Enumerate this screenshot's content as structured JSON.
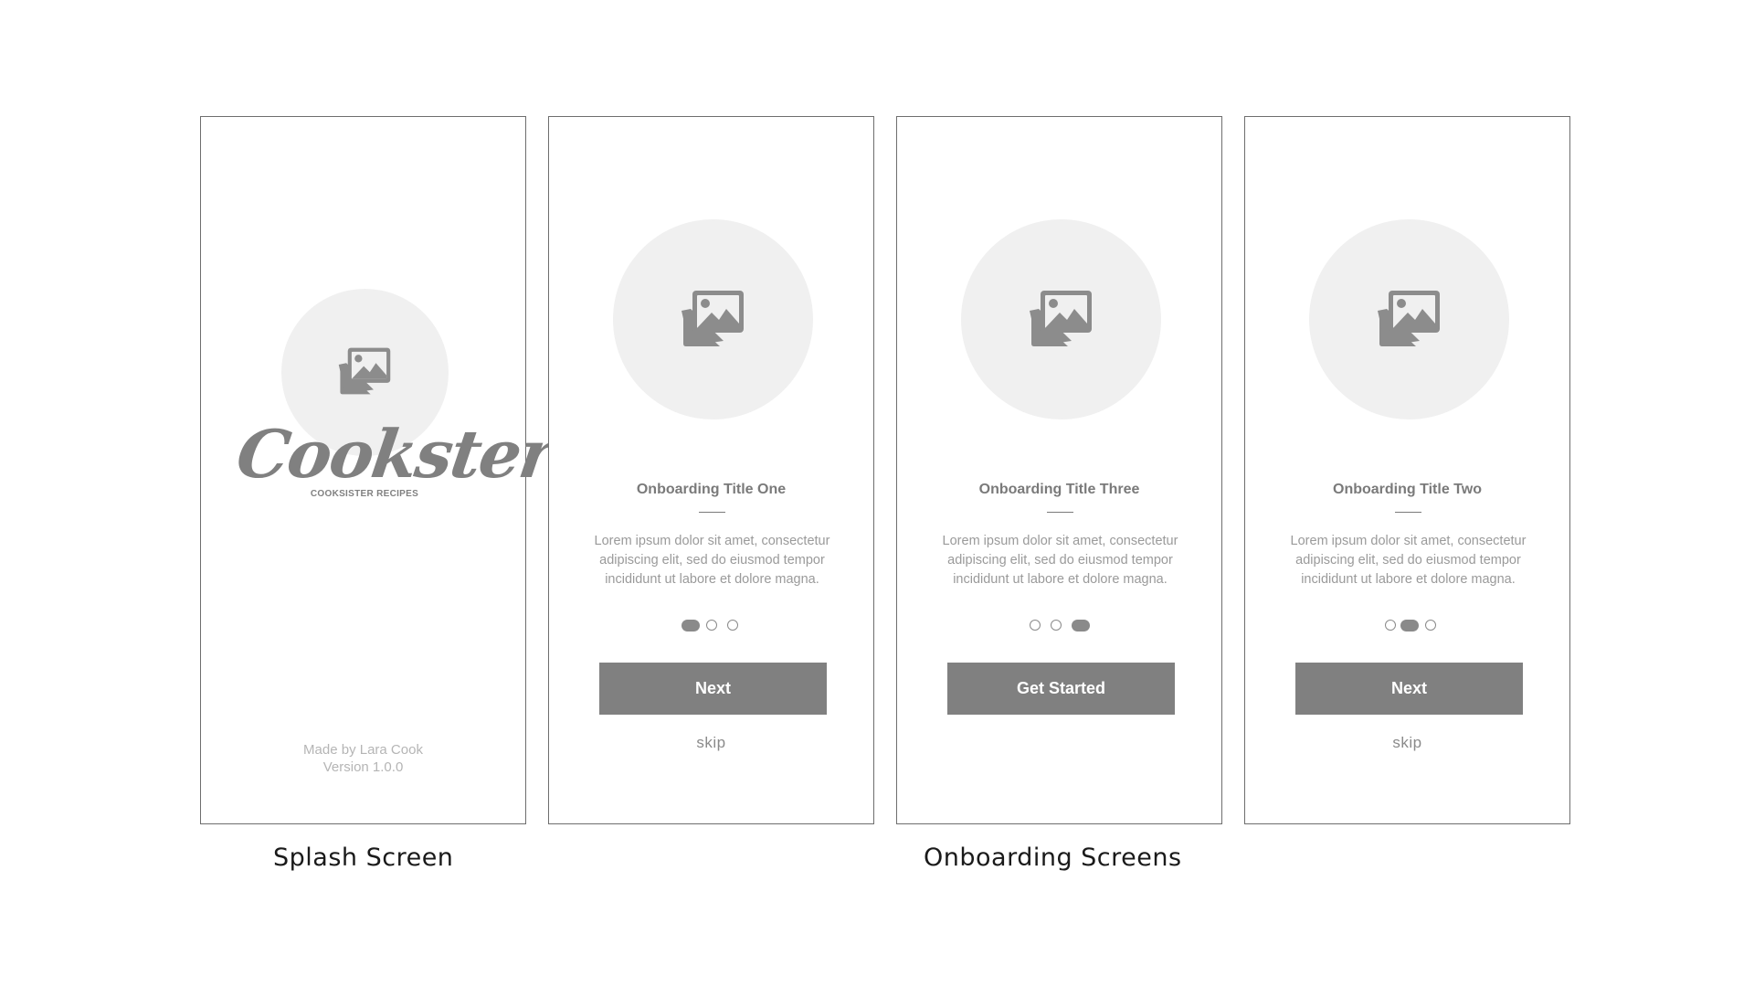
{
  "splash": {
    "logo_text": "Cookster",
    "logo_subtitle": "COOKSISTER RECIPES",
    "footer_line1": "Made by Lara Cook",
    "footer_line2": "Version 1.0.0",
    "icon": "image-placeholder-icon"
  },
  "onboarding_screens": [
    {
      "title": "Onboarding Title One",
      "body": "Lorem ipsum dolor sit amet, consectetur adipiscing elit, sed do eiusmod tempor incididunt ut labore et dolore magna.",
      "button_label": "Next",
      "skip_label": "skip",
      "active_dot": 1,
      "total_dots": 3
    },
    {
      "title": "Onboarding Title Three",
      "body": "Lorem ipsum dolor sit amet, consectetur adipiscing elit, sed do eiusmod tempor incididunt ut labore et dolore magna.",
      "button_label": "Get Started",
      "active_dot": 3,
      "total_dots": 3
    },
    {
      "title": "Onboarding Title Two",
      "body": "Lorem ipsum dolor sit amet, consectetur adipiscing elit, sed do eiusmod tempor incididunt ut labore et dolore magna.",
      "button_label": "Next",
      "skip_label": "skip",
      "active_dot": 2,
      "total_dots": 3
    }
  ],
  "captions": {
    "splash": "Splash Screen",
    "onboarding": "Onboarding Screens"
  },
  "colors": {
    "frame_border": "#6e6e6e",
    "placeholder_fill": "#f0f0f0",
    "button_fill": "#808080",
    "text_gray": "#7a7a7a"
  }
}
